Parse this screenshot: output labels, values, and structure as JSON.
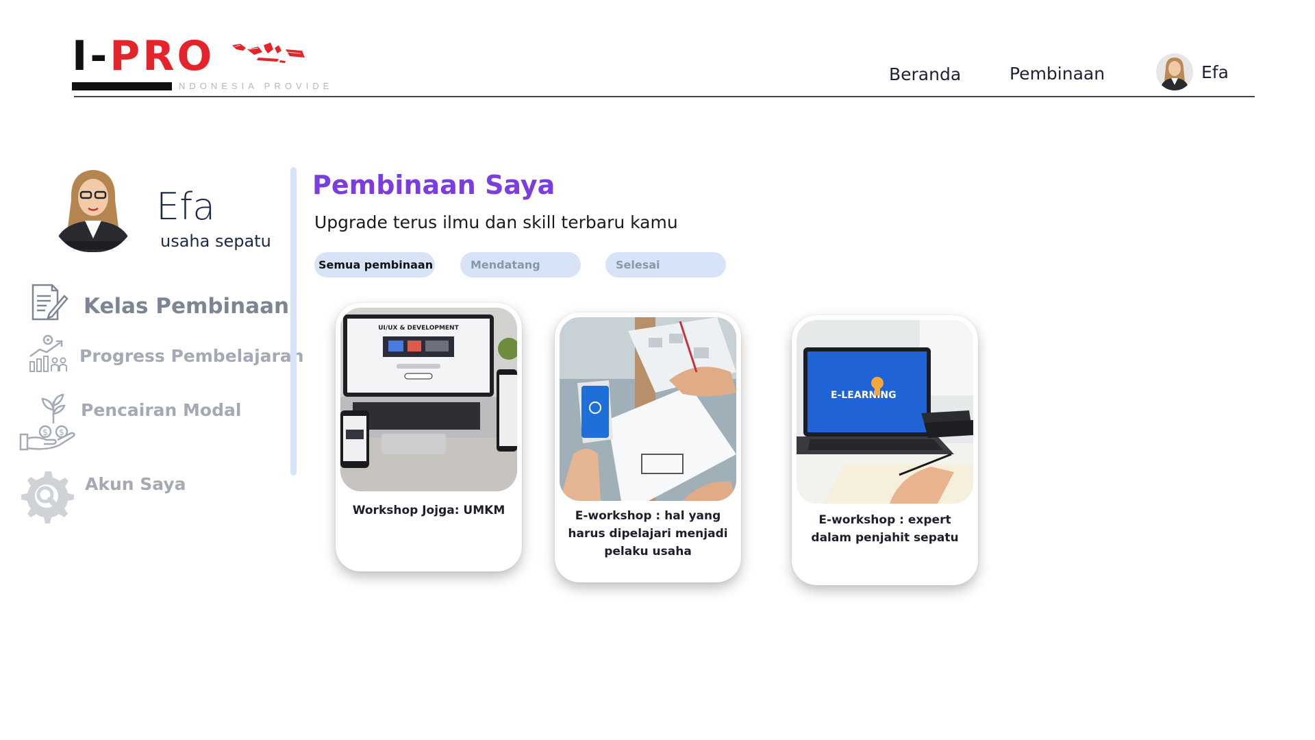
{
  "header": {
    "logo": {
      "text_i": "I-",
      "text_pro": "PRO",
      "tagline": "NDONESIA PROVIDE",
      "icon": "indonesia-map-icon"
    },
    "nav": {
      "home": "Beranda",
      "coaching": "Pembinaan",
      "user_name": "Efa"
    }
  },
  "profile": {
    "name": "Efa",
    "business": "usaha sepatu"
  },
  "sidebar": {
    "items": [
      {
        "label": "Kelas Pembinaan",
        "icon": "document-pen-icon"
      },
      {
        "label": "Progress Pembelajaran",
        "icon": "growth-chart-icon"
      },
      {
        "label": "Pencairan Modal",
        "icon": "money-plant-hand-icon"
      },
      {
        "label": "Akun Saya",
        "icon": "gear-search-icon"
      }
    ]
  },
  "main": {
    "title": "Pembinaan Saya",
    "subtitle": "Upgrade terus ilmu dan skill terbaru kamu",
    "filters": [
      "Semua pembinaan",
      "Mendatang",
      "Selesai"
    ],
    "cards": [
      {
        "title": "Workshop Jojga: UMKM",
        "image_text": "UI/UX & DEVELOPMENT"
      },
      {
        "title": "E-workshop : hal yang harus dipelajari menjadi pelaku usaha"
      },
      {
        "title": "E-workshop : expert dalam penjahit sepatu",
        "image_text": "E-LEARNING"
      }
    ]
  },
  "colors": {
    "accent_purple": "#7b3ce0",
    "pill_bg": "#d7e4f7",
    "logo_red": "#e5232a",
    "sidebar_active": "#7b8594",
    "sidebar_inactive": "#a3aab5"
  }
}
